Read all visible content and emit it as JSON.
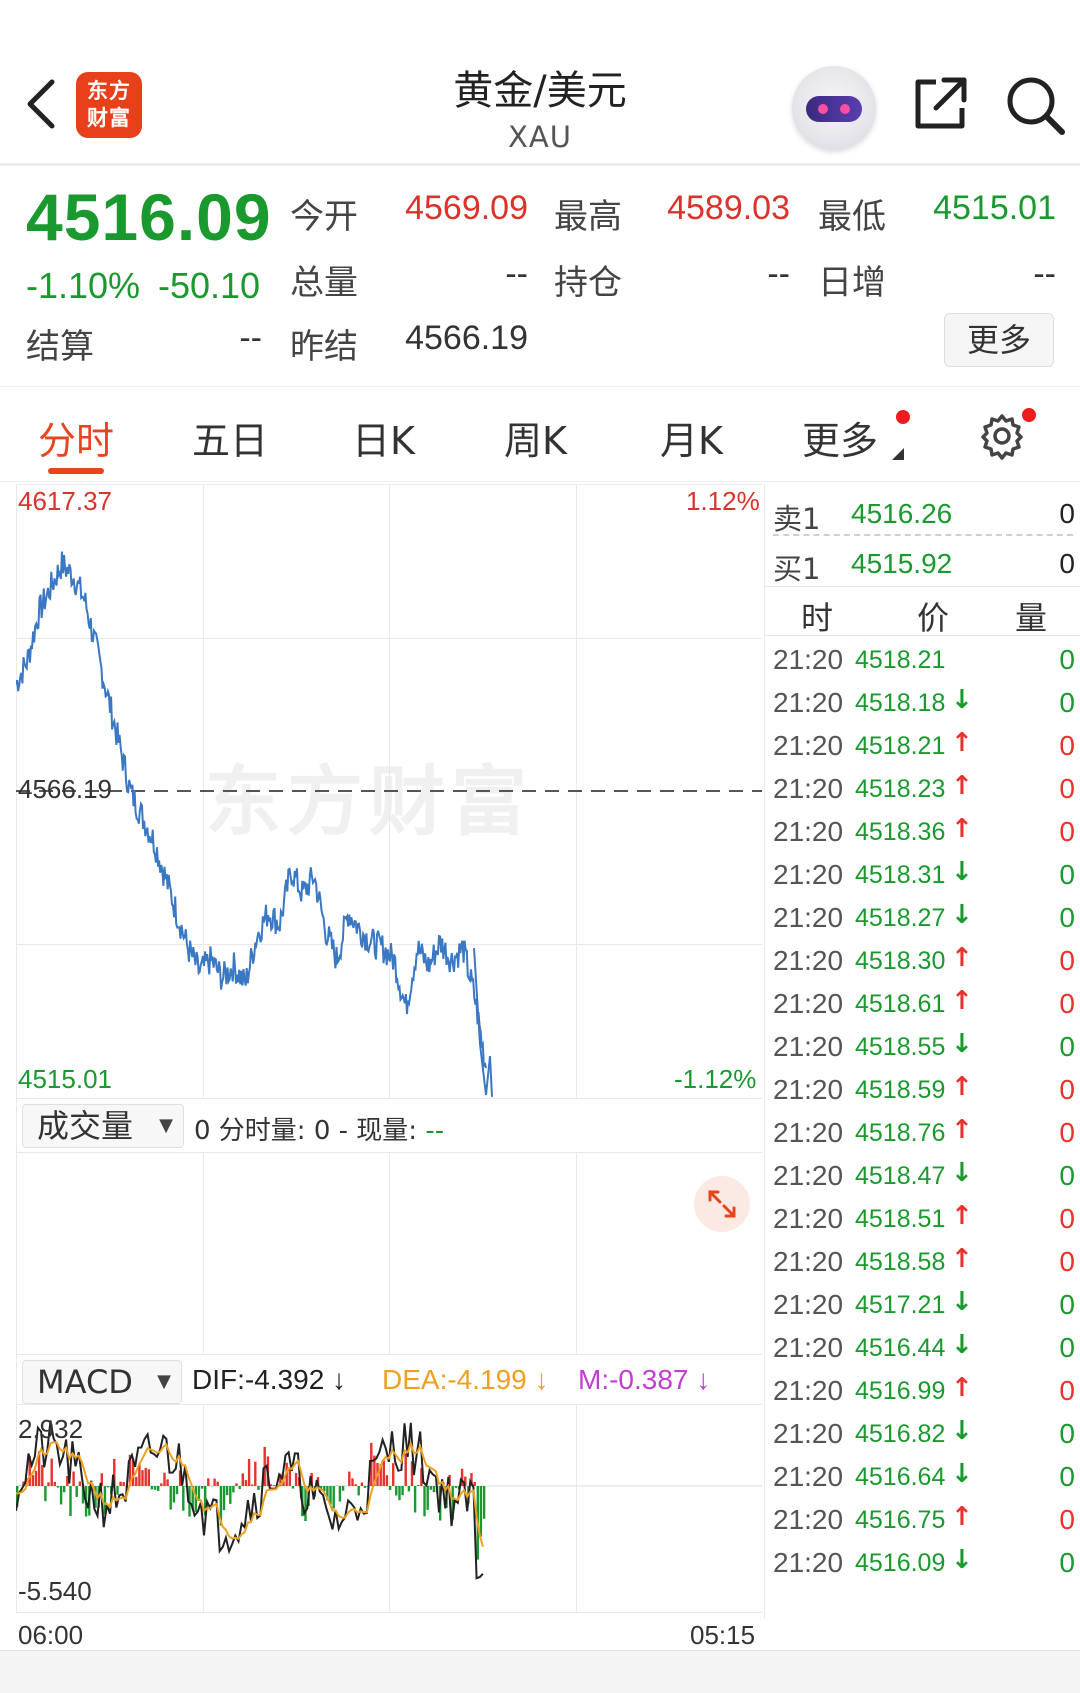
{
  "header": {
    "logo_line1": "东方",
    "logo_line2": "财富",
    "title": "黄金/美元",
    "subtitle": "XAU"
  },
  "quote": {
    "price": "4516.09",
    "change_pct": "-1.10%",
    "change": "-50.10",
    "fields": [
      {
        "label": "今开",
        "value": "4569.09",
        "color": "red"
      },
      {
        "label": "最高",
        "value": "4589.03",
        "color": "red"
      },
      {
        "label": "最低",
        "value": "4515.01",
        "color": "green"
      },
      {
        "label": "总量",
        "value": "--",
        "color": "dark"
      },
      {
        "label": "持仓",
        "value": "--",
        "color": "dark"
      },
      {
        "label": "日增",
        "value": "--",
        "color": "dark"
      },
      {
        "label": "结算",
        "value": "--",
        "color": "dark"
      },
      {
        "label": "昨结",
        "value": "4566.19",
        "color": "dark"
      }
    ],
    "more_label": "更多"
  },
  "tabs": [
    {
      "label": "分时",
      "active": true
    },
    {
      "label": "五日",
      "active": false
    },
    {
      "label": "日K",
      "active": false
    },
    {
      "label": "周K",
      "active": false
    },
    {
      "label": "月K",
      "active": false
    },
    {
      "label": "更多",
      "active": false
    }
  ],
  "chart": {
    "y_max_label": "4617.37",
    "y_mid_label": "4566.19",
    "y_min_label": "4515.01",
    "pct_max_label": "1.12%",
    "pct_min_label": "-1.12%",
    "watermark": "东方财富",
    "volume_selector": "成交量",
    "volume_text_prefix": "0 分时量: 0 - 现量: ",
    "volume_text_value": "--",
    "macd_selector": "MACD",
    "dif_text": "DIF:-4.392 ↓",
    "dea_text": "DEA:-4.199 ↓",
    "m_text": "M:-0.387 ↓",
    "macd_max_label": "2.932",
    "macd_min_label": "-5.540",
    "x_start_label": "06:00",
    "x_end_label": "05:15",
    "colors": {
      "price_line": "#3a78c4",
      "up": "#e8322b",
      "down": "#1a9a2e",
      "dif": "#222222",
      "dea": "#f0a020",
      "m": "#c03fd0"
    }
  },
  "chart_data": {
    "type": "line",
    "title": "",
    "xlabel": "",
    "ylabel": "",
    "x_range": [
      "06:00",
      "05:15"
    ],
    "ylim": [
      4515.01,
      4617.37
    ],
    "reference_line": 4566.19,
    "series": [
      {
        "values": [
          4584,
          4588,
          4596,
          4600,
          4604,
          4602,
          4598,
          4590,
          4582,
          4574,
          4566,
          4562,
          4558,
          4552,
          4546,
          4540,
          4536,
          4538,
          4535,
          4537,
          4534,
          4542,
          4546,
          4544,
          4553,
          4549,
          4552,
          4543,
          4538,
          4546,
          4543,
          4541,
          4540,
          4538,
          4530,
          4540,
          4537,
          4541,
          4538,
          4540,
          4532,
          4520
        ]
      }
    ]
  },
  "order_book": {
    "sell_label": "卖1",
    "sell_price": "4516.26",
    "sell_qty": "0",
    "buy_label": "买1",
    "buy_price": "4515.92",
    "buy_qty": "0"
  },
  "ticks_header": {
    "time": "时",
    "price": "价",
    "qty": "量"
  },
  "ticks": [
    {
      "time": "21:20",
      "price": "4518.21",
      "dir": "",
      "qty": "0"
    },
    {
      "time": "21:20",
      "price": "4518.18",
      "dir": "↓",
      "qty": "0"
    },
    {
      "time": "21:20",
      "price": "4518.21",
      "dir": "↑",
      "qty": "0"
    },
    {
      "time": "21:20",
      "price": "4518.23",
      "dir": "↑",
      "qty": "0"
    },
    {
      "time": "21:20",
      "price": "4518.36",
      "dir": "↑",
      "qty": "0"
    },
    {
      "time": "21:20",
      "price": "4518.31",
      "dir": "↓",
      "qty": "0"
    },
    {
      "time": "21:20",
      "price": "4518.27",
      "dir": "↓",
      "qty": "0"
    },
    {
      "time": "21:20",
      "price": "4518.30",
      "dir": "↑",
      "qty": "0"
    },
    {
      "time": "21:20",
      "price": "4518.61",
      "dir": "↑",
      "qty": "0"
    },
    {
      "time": "21:20",
      "price": "4518.55",
      "dir": "↓",
      "qty": "0"
    },
    {
      "time": "21:20",
      "price": "4518.59",
      "dir": "↑",
      "qty": "0"
    },
    {
      "time": "21:20",
      "price": "4518.76",
      "dir": "↑",
      "qty": "0"
    },
    {
      "time": "21:20",
      "price": "4518.47",
      "dir": "↓",
      "qty": "0"
    },
    {
      "time": "21:20",
      "price": "4518.51",
      "dir": "↑",
      "qty": "0"
    },
    {
      "time": "21:20",
      "price": "4518.58",
      "dir": "↑",
      "qty": "0"
    },
    {
      "time": "21:20",
      "price": "4517.21",
      "dir": "↓",
      "qty": "0"
    },
    {
      "time": "21:20",
      "price": "4516.44",
      "dir": "↓",
      "qty": "0"
    },
    {
      "time": "21:20",
      "price": "4516.99",
      "dir": "↑",
      "qty": "0"
    },
    {
      "time": "21:20",
      "price": "4516.82",
      "dir": "↓",
      "qty": "0"
    },
    {
      "time": "21:20",
      "price": "4516.64",
      "dir": "↓",
      "qty": "0"
    },
    {
      "time": "21:20",
      "price": "4516.75",
      "dir": "↑",
      "qty": "0"
    },
    {
      "time": "21:20",
      "price": "4516.09",
      "dir": "↓",
      "qty": "0"
    }
  ],
  "icons": {
    "back": "chevron-left-icon",
    "share": "share-external-icon",
    "search": "search-icon",
    "settings": "gear-icon",
    "expand": "expand-arrows-icon",
    "assistant": "robot-assistant-icon"
  }
}
